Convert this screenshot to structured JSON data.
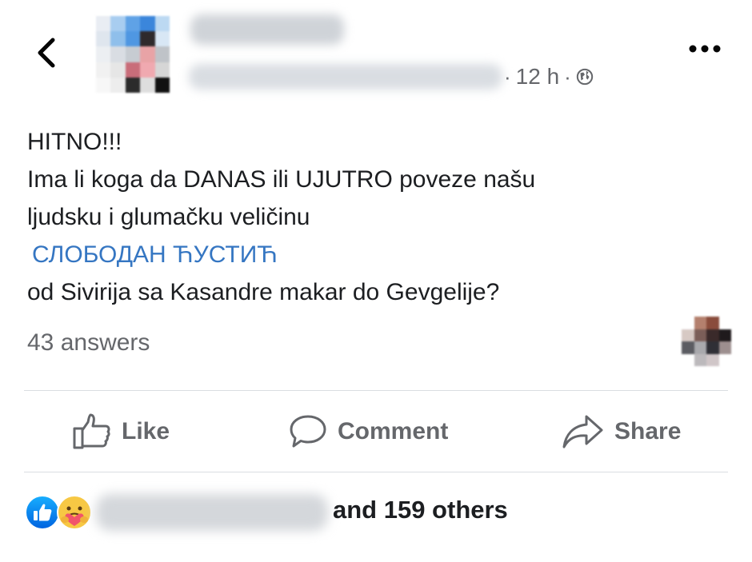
{
  "header": {
    "timestamp": "12 h",
    "separator": "·",
    "back_icon": "chevron-left-icon",
    "privacy_icon": "globe-icon",
    "more_icon": "more-dots-icon"
  },
  "post": {
    "lines": [
      "HITNO!!!",
      "Ima li koga da DANAS ili UJUTRO poveze našu",
      "ljudsku i glumačku veličinu"
    ],
    "mention": "СЛОБОДАН ЋУСТИЋ",
    "last_line": "od Sivirija sa Kasandre makar do Gevgelije?",
    "answers": "43 answers"
  },
  "actions": {
    "like": "Like",
    "comment": "Comment",
    "share": "Share"
  },
  "reactions": {
    "others": "and 159 others",
    "icons": [
      "like-reaction-icon",
      "care-reaction-icon"
    ]
  },
  "colors": {
    "mention": "#3576c2",
    "secondary_text": "#65676b",
    "like_blue": "#1877f2",
    "care_yellow": "#f7c844"
  }
}
